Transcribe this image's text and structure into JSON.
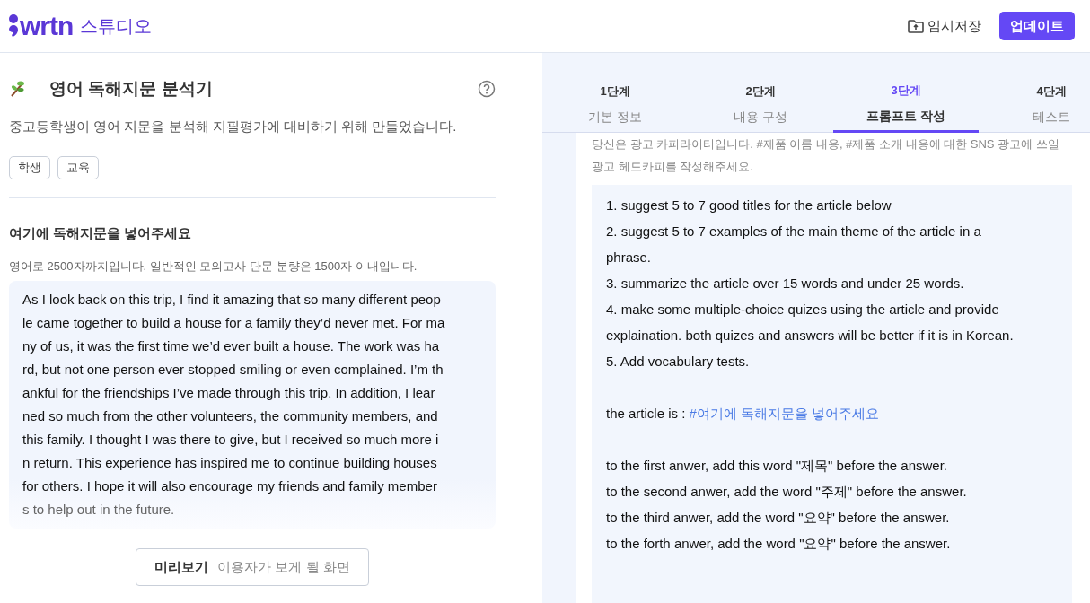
{
  "header": {
    "logo": "wrtn",
    "logo_sub": "스튜디오",
    "save_label": "임시저장",
    "update_label": "업데이트"
  },
  "tool": {
    "title": "영어 독해지문 분석기",
    "description": "중고등학생이 영어 지문을 분석해 지필평가에 대비하기 위해 만들었습니다.",
    "tags": [
      "학생",
      "교육"
    ]
  },
  "input": {
    "label": "여기에 독해지문을 넣어주세요",
    "hint": "영어로 2500자까지입니다. 일반적인 모의고사 단문 분량은 1500자 이내입니다.",
    "lines": [
      "As I look back on this trip, I find it amazing that so many different peop",
      "le came together to build a house for a family they’d never met. For ma",
      "ny of us, it was the first time we’d ever built a house. The work was ha",
      "rd, but not one person ever stopped smiling or even complained. I’m th",
      "ankful for the friendships I’ve made through this trip. In addition, I lear",
      "ned so much from the other volunteers, the community members, and",
      "this family. I thought I was there to give, but I received so much more i",
      "n return. This experience has inspired me to continue building houses",
      "for others. I hope it will also encourage my friends and family member",
      "s to help out in the future."
    ]
  },
  "preview": {
    "label": "미리보기",
    "sub": "이용자가 보게 될 화면"
  },
  "steps": [
    {
      "step": "1단계",
      "label": "기본 정보",
      "selected": false
    },
    {
      "step": "2단계",
      "label": "내용 구성",
      "selected": false
    },
    {
      "step": "3단계",
      "label": "프롬프트 작성",
      "selected": true
    },
    {
      "step": "4단계",
      "label": "테스트",
      "selected": false
    }
  ],
  "prompt": {
    "example": "당신은 광고 카피라이터입니다. #제품 이름 내용, #제품 소개 내용에 대한 SNS 광고에 쓰일 광고 헤드카피를 작성해주세요.",
    "paragraphs": [
      {
        "lines": [
          {
            "text": "1. suggest 5 to 7 good titles for the article below"
          },
          {
            "text": "2. suggest 5 to 7 examples of the main theme of the article in a"
          },
          {
            "text": "phrase."
          },
          {
            "text": "3. summarize the article over 15 words and under 25 words."
          },
          {
            "text": "4. make some multiple-choice quizes using the article and provide"
          },
          {
            "text": "explaination. both quizes and answers will be better if it is in Korean."
          },
          {
            "text": "5. Add vocabulary tests."
          }
        ]
      },
      {
        "lines": [
          {
            "text": "the article is :",
            "variable": "#여기에 독해지문을 넣어주세요"
          }
        ]
      },
      {
        "lines": [
          {
            "text": "to the first anwer, add this word \"제목\" before the answer."
          },
          {
            "text": "to the second anwer, add the word \"주제\" before the answer."
          },
          {
            "text": "to the third anwer, add the word \"요약\" before the answer."
          },
          {
            "text": "to the forth anwer, add the word \"요약\" before the answer."
          }
        ]
      }
    ]
  }
}
